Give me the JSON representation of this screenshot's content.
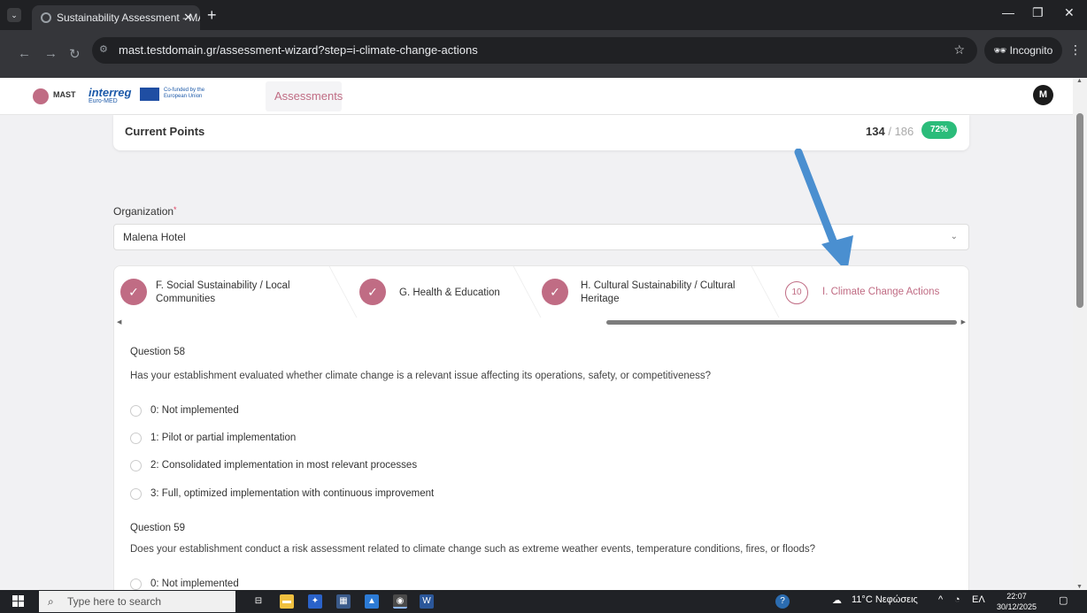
{
  "browser": {
    "tab_title": "Sustainability Assessment - MA",
    "url": "mast.testdomain.gr/assessment-wizard?step=i-climate-change-actions",
    "incognito_label": "Incognito"
  },
  "header": {
    "logo_mast": "MAST",
    "logo_interreg": "interreg",
    "logo_interreg_sub": "Euro-MED",
    "logo_eu_text": "Co-funded by the European Union",
    "assessments_menu": "Assessments",
    "avatar_initial": "M"
  },
  "points": {
    "label": "Current Points",
    "current": "134",
    "separator": "/",
    "total": "186",
    "percent": "72%"
  },
  "organization": {
    "label": "Organization",
    "required_mark": "*",
    "value": "Malena Hotel"
  },
  "steps": [
    {
      "label": "F. Social Sustainability / Local Communities",
      "status": "completed"
    },
    {
      "label": "G. Health & Education",
      "status": "completed"
    },
    {
      "label": "H. Cultural Sustainability / Cultural Heritage",
      "status": "completed"
    },
    {
      "number": "10",
      "label": "I. Climate Change Actions",
      "status": "active"
    }
  ],
  "questions": [
    {
      "title": "Question 58",
      "text": "Has your establishment evaluated whether climate change is a relevant issue affecting its operations, safety, or competitiveness?",
      "options": [
        "0: Not implemented",
        "1: Pilot or partial implementation",
        "2: Consolidated implementation in most relevant processes",
        "3: Full, optimized implementation with continuous improvement"
      ]
    },
    {
      "title": "Question 59",
      "text": "Does your establishment conduct a risk assessment related to climate change such as extreme weather events, temperature conditions, fires, or floods?",
      "options": [
        "0: Not implemented"
      ]
    }
  ],
  "taskbar": {
    "search_placeholder": "Type here to search",
    "weather": "11°C Νεφώσεις",
    "lang": "ΕΛ",
    "time": "22:07",
    "date": "30/12/2025"
  },
  "colors": {
    "accent": "#c06c84",
    "badge_green": "#2bbc7a",
    "arrow_blue": "#4a8fd0"
  }
}
